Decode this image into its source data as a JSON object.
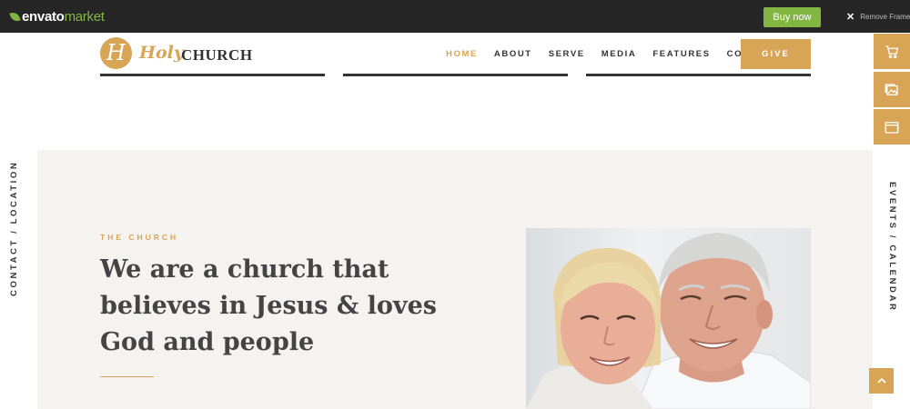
{
  "envato": {
    "logo_word": "envato",
    "logo_market": "market",
    "buy_now": "Buy now",
    "remove_frame": "Remove Frame"
  },
  "header": {
    "logo_letter": "H",
    "logo_holy": "Holy",
    "logo_church": "CHURCH",
    "nav": [
      "HOME",
      "ABOUT",
      "SERVE",
      "MEDIA",
      "FEATURES",
      "CONTACTS"
    ],
    "active_nav": "HOME",
    "give_label": "GIVE"
  },
  "side_tools": [
    "cart-icon",
    "gallery-icon",
    "browser-window-icon"
  ],
  "sidebar": {
    "left_label": "CONTACT / LOCATION",
    "right_label": "EVENTS / CALENDAR"
  },
  "hero": {
    "eyebrow": "THE CHURCH",
    "headline": "We are a church that believes in Jesus & loves God and people"
  },
  "colors": {
    "accent": "#d8a556",
    "envato_green": "#82b541",
    "dark": "#333333",
    "section_bg": "#f5f3f0"
  }
}
